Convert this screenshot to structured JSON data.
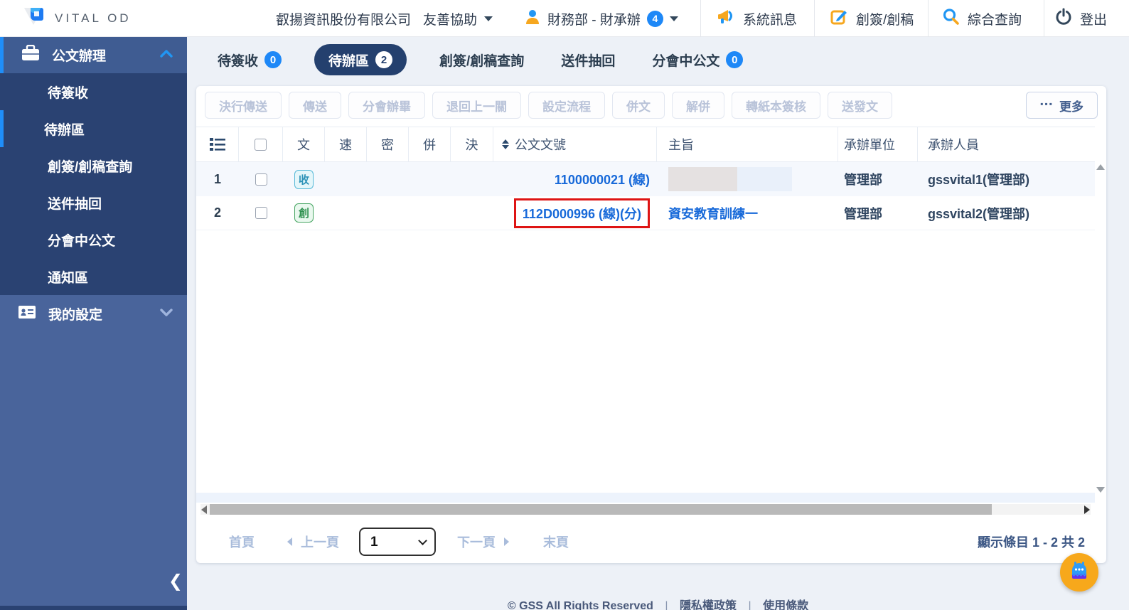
{
  "header": {
    "logo": "VITAL OD",
    "company": "叡揚資訊股份有限公司",
    "help": "友善協助",
    "user_name": "財務部 - 財承辦",
    "user_badge": "4",
    "messages": "系統訊息",
    "create": "創簽/創稿",
    "search": "綜合查詢",
    "logout": "登出"
  },
  "sidebar": {
    "section_docs": "公文辦理",
    "items": [
      {
        "label": "待簽收"
      },
      {
        "label": "待辦區"
      },
      {
        "label": "創簽/創稿查詢"
      },
      {
        "label": "送件抽回"
      },
      {
        "label": "分會中公文"
      },
      {
        "label": "通知區"
      }
    ],
    "section_settings": "我的設定"
  },
  "tabs": [
    {
      "label": "待簽收",
      "badge": "0"
    },
    {
      "label": "待辦區",
      "badge": "2",
      "active": true
    },
    {
      "label": "創簽/創稿查詢"
    },
    {
      "label": "送件抽回"
    },
    {
      "label": "分會中公文",
      "badge": "0"
    }
  ],
  "toolbar": {
    "buttons": [
      {
        "label": "決行傳送"
      },
      {
        "label": "傳送"
      },
      {
        "label": "分會辦畢"
      },
      {
        "label": "退回上一關"
      },
      {
        "label": "設定流程"
      },
      {
        "label": "併文"
      },
      {
        "label": "解併"
      },
      {
        "label": "轉紙本簽核"
      },
      {
        "label": "送發文"
      }
    ],
    "more": "更多"
  },
  "table": {
    "headers": {
      "doc_type": "文",
      "speed": "速",
      "secret": "密",
      "merge": "併",
      "decide": "決",
      "doc_no": "公文文號",
      "subject": "主旨",
      "unit": "承辦單位",
      "person": "承辦人員"
    },
    "rows": [
      {
        "idx": "1",
        "type": "收",
        "doc_no": "1100000021 (線)",
        "subject": "",
        "unit": "管理部",
        "person": "gssvital1(管理部)"
      },
      {
        "idx": "2",
        "type": "創",
        "doc_no": "112D000996 (線)(分)",
        "subject": "資安教育訓練一",
        "unit": "管理部",
        "person": "gssvital2(管理部)"
      }
    ]
  },
  "pagination": {
    "first": "首頁",
    "prev": "上一頁",
    "page": "1",
    "next": "下一頁",
    "last": "末頁",
    "info": "顯示條目 1 - 2 共 2"
  },
  "footer": {
    "copyright": "© GSS All Rights Reserved",
    "divider": "|",
    "privacy": "隱私權政策",
    "terms": "使用條款"
  },
  "colors": {
    "accent_blue": "#1e88f7",
    "accent_orange": "#f6a71f",
    "sidebar_dark": "#2a4272",
    "sidebar_light": "#49649b",
    "active_pill": "#24406e",
    "link_blue": "#1769d9",
    "annotation_red": "#de1414",
    "recv_badge_border": "#56b9d8",
    "create_badge_border": "#46a562"
  }
}
